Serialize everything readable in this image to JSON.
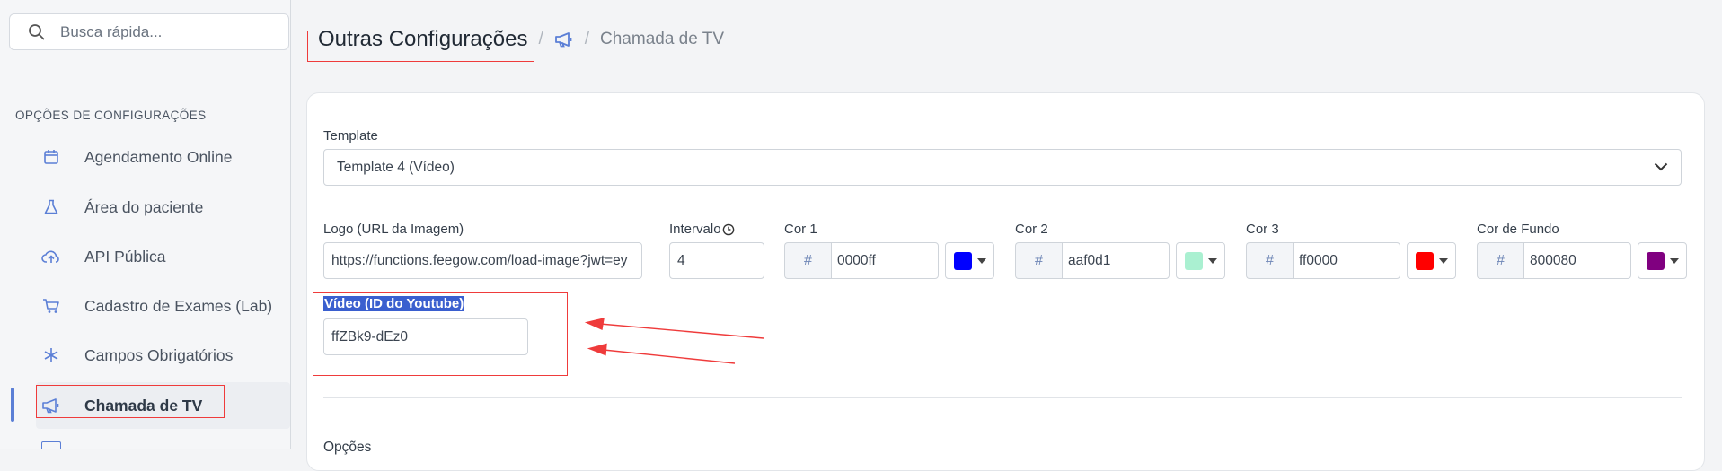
{
  "search": {
    "placeholder": "Busca rápida..."
  },
  "sidebar": {
    "section_title": "OPÇÕES DE CONFIGURAÇÕES",
    "items": [
      {
        "label": "Agendamento Online",
        "icon": "calendar-icon"
      },
      {
        "label": "Área do paciente",
        "icon": "flask-icon"
      },
      {
        "label": "API Pública",
        "icon": "cloud-upload-icon"
      },
      {
        "label": "Cadastro de Exames (Lab)",
        "icon": "cart-icon"
      },
      {
        "label": "Campos Obrigatórios",
        "icon": "asterisk-icon"
      },
      {
        "label": "Chamada de TV",
        "icon": "megaphone-icon",
        "active": true
      }
    ]
  },
  "breadcrumb": {
    "title": "Outras Configurações",
    "separator": "/",
    "current": "Chamada de TV"
  },
  "form": {
    "template": {
      "label": "Template",
      "value": "Template 4 (Vídeo)"
    },
    "logo": {
      "label": "Logo (URL da Imagem)",
      "value": "https://functions.feegow.com/load-image?jwt=ey"
    },
    "intervalo": {
      "label": "Intervalo",
      "value": "4"
    },
    "cor1": {
      "label": "Cor 1",
      "prefix": "#",
      "value": "0000ff",
      "swatch": "#0000ff"
    },
    "cor2": {
      "label": "Cor 2",
      "prefix": "#",
      "value": "aaf0d1",
      "swatch": "#aaf0d1"
    },
    "cor3": {
      "label": "Cor 3",
      "prefix": "#",
      "value": "ff0000",
      "swatch": "#ff0000"
    },
    "cor_fundo": {
      "label": "Cor de Fundo",
      "prefix": "#",
      "value": "800080",
      "swatch": "#800080"
    },
    "video": {
      "label": "Vídeo (ID do Youtube)",
      "value": "ffZBk9-dEz0"
    },
    "opcoes_heading": "Opções"
  },
  "colors": {
    "accent": "#5b7fd6",
    "annotation": "#ef3b3b",
    "selection": "#3a5fcf"
  }
}
